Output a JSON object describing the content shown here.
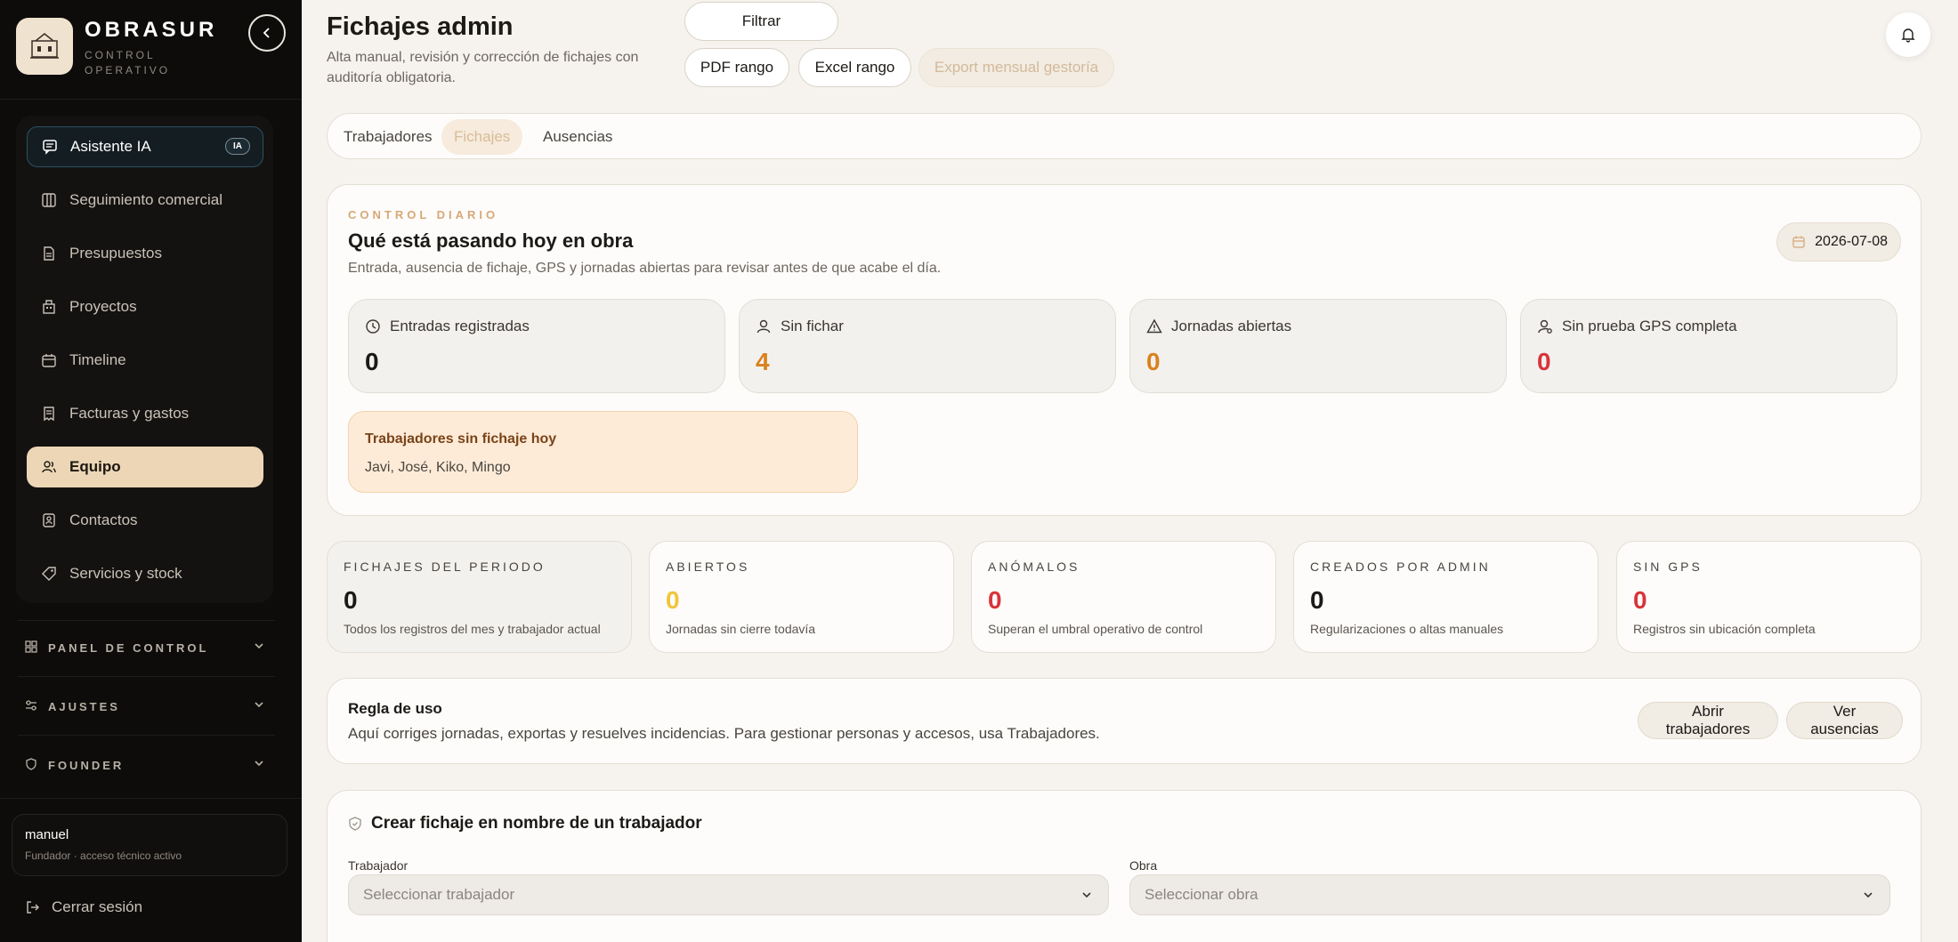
{
  "sidebar": {
    "brand_name": "OBRASUR",
    "brand_sub": "CONTROL OPERATIVO",
    "logo_text": "OBRASUR",
    "nav": [
      {
        "label": "Asistente IA",
        "icon": "chat-icon",
        "badge": "IA"
      },
      {
        "label": "Seguimiento comercial",
        "icon": "columns-icon"
      },
      {
        "label": "Presupuestos",
        "icon": "document-icon"
      },
      {
        "label": "Proyectos",
        "icon": "building-icon"
      },
      {
        "label": "Timeline",
        "icon": "calendar-icon"
      },
      {
        "label": "Facturas y gastos",
        "icon": "receipt-icon"
      },
      {
        "label": "Equipo",
        "icon": "users-icon",
        "active": true
      },
      {
        "label": "Contactos",
        "icon": "contact-icon"
      },
      {
        "label": "Servicios y stock",
        "icon": "tag-icon"
      }
    ],
    "sections": [
      {
        "label": "PANEL DE CONTROL",
        "icon": "grid-icon"
      },
      {
        "label": "AJUSTES",
        "icon": "sliders-icon"
      },
      {
        "label": "FOUNDER",
        "icon": "shield-icon"
      }
    ],
    "user": {
      "name": "manuel",
      "role": "Fundador · acceso técnico activo"
    },
    "logout": "Cerrar sesión"
  },
  "header": {
    "title": "Fichajes admin",
    "subtitle": "Alta manual, revisión y corrección de fichajes con auditoría obligatoria.",
    "buttons": {
      "filter": "Filtrar",
      "pdf": "PDF rango",
      "excel": "Excel rango",
      "export": "Export mensual gestoría"
    }
  },
  "tabs": [
    "Trabajadores",
    "Fichajes",
    "Ausencias"
  ],
  "active_tab": "Fichajes",
  "daily": {
    "eyebrow": "CONTROL DIARIO",
    "title": "Qué está pasando hoy en obra",
    "description": "Entrada, ausencia de fichaje, GPS y jornadas abiertas para revisar antes de que acabe el día.",
    "date": "2026-07-08",
    "stats": [
      {
        "label": "Entradas registradas",
        "value": "0",
        "icon": "clock-icon",
        "color": "#1c1a17"
      },
      {
        "label": "Sin fichar",
        "value": "4",
        "icon": "user-icon",
        "color": "#d9821e"
      },
      {
        "label": "Jornadas abiertas",
        "value": "0",
        "icon": "warning-icon",
        "color": "#d9821e"
      },
      {
        "label": "Sin prueba GPS completa",
        "value": "0",
        "icon": "location-user-icon",
        "color": "#d8343a"
      }
    ],
    "alert": {
      "title": "Trabajadores sin fichaje hoy",
      "text": "Javi, José, Kiko, Mingo"
    }
  },
  "kpis": [
    {
      "label": "FICHAJES DEL PERIODO",
      "value": "0",
      "note": "Todos los registros del mes y trabajador actual",
      "color": "#1c1a17"
    },
    {
      "label": "ABIERTOS",
      "value": "0",
      "note": "Jornadas sin cierre todavía",
      "color": "#f0c53a"
    },
    {
      "label": "ANÓMALOS",
      "value": "0",
      "note": "Superan el umbral operativo de control",
      "color": "#d8343a"
    },
    {
      "label": "CREADOS POR ADMIN",
      "value": "0",
      "note": "Regularizaciones o altas manuales",
      "color": "#1c1a17"
    },
    {
      "label": "SIN GPS",
      "value": "0",
      "note": "Registros sin ubicación completa",
      "color": "#d8343a"
    }
  ],
  "rule": {
    "title": "Regla de uso",
    "text": "Aquí corriges jornadas, exportas y resuelves incidencias. Para gestionar personas y accesos, usa Trabajadores.",
    "open_workers": "Abrir trabajadores",
    "view_absences": "Ver ausencias"
  },
  "form": {
    "title": "Crear fichaje en nombre de un trabajador",
    "worker_label": "Trabajador",
    "worker_placeholder": "Seleccionar trabajador",
    "site_label": "Obra",
    "site_placeholder": "Seleccionar obra"
  }
}
